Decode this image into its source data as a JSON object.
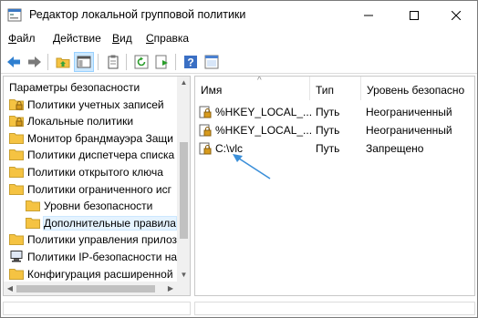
{
  "window": {
    "title": "Редактор локальной групповой политики",
    "controls": {
      "minimize": "—",
      "maximize": "☐",
      "close": "✕"
    }
  },
  "menu": [
    {
      "key": "Ф",
      "rest": "айл"
    },
    {
      "key": "Д",
      "rest": "ействие"
    },
    {
      "key": "В",
      "rest": "ид"
    },
    {
      "key": "С",
      "rest": "правка"
    }
  ],
  "toolbar": {
    "icons": [
      "back-arrow-icon",
      "forward-arrow-icon",
      "up-folder-icon",
      "show-hide-tree-icon",
      "clipboard-icon",
      "refresh-icon",
      "export-list-icon",
      "help-icon",
      "properties-icon"
    ]
  },
  "tree": {
    "items": [
      {
        "label": "Параметры безопасности",
        "icon": "none",
        "indent": 0
      },
      {
        "label": "Политики учетных записей",
        "icon": "folder-lock",
        "indent": 1
      },
      {
        "label": "Локальные политики",
        "icon": "folder-lock",
        "indent": 1
      },
      {
        "label": "Монитор брандмауэра Защи",
        "icon": "folder",
        "indent": 1
      },
      {
        "label": "Политики диспетчера списка",
        "icon": "folder",
        "indent": 1
      },
      {
        "label": "Политики открытого ключа",
        "icon": "folder",
        "indent": 1
      },
      {
        "label": "Политики ограниченного исг",
        "icon": "folder",
        "indent": 1
      },
      {
        "label": "Уровни безопасности",
        "icon": "folder",
        "indent": 2
      },
      {
        "label": "Дополнительные правила",
        "icon": "folder",
        "indent": 2,
        "selected": true
      },
      {
        "label": "Политики управления прилоз",
        "icon": "folder",
        "indent": 1
      },
      {
        "label": "Политики IP-безопасности на",
        "icon": "computer",
        "indent": 1
      },
      {
        "label": "Конфигурация расширенной",
        "icon": "folder",
        "indent": 1
      }
    ]
  },
  "list": {
    "columns": [
      "Имя",
      "Тип",
      "Уровень безопасно"
    ],
    "rows": [
      {
        "name": "%HKEY_LOCAL_...",
        "type": "Путь",
        "level": "Неограниченный"
      },
      {
        "name": "%HKEY_LOCAL_...",
        "type": "Путь",
        "level": "Неограниченный"
      },
      {
        "name": "C:\\vlc",
        "type": "Путь",
        "level": "Запрещено"
      }
    ]
  },
  "colors": {
    "accent": "#0078d7",
    "folder": "#f5c342",
    "arrow": "#3b8fd9",
    "selection": "#e5f3ff"
  }
}
